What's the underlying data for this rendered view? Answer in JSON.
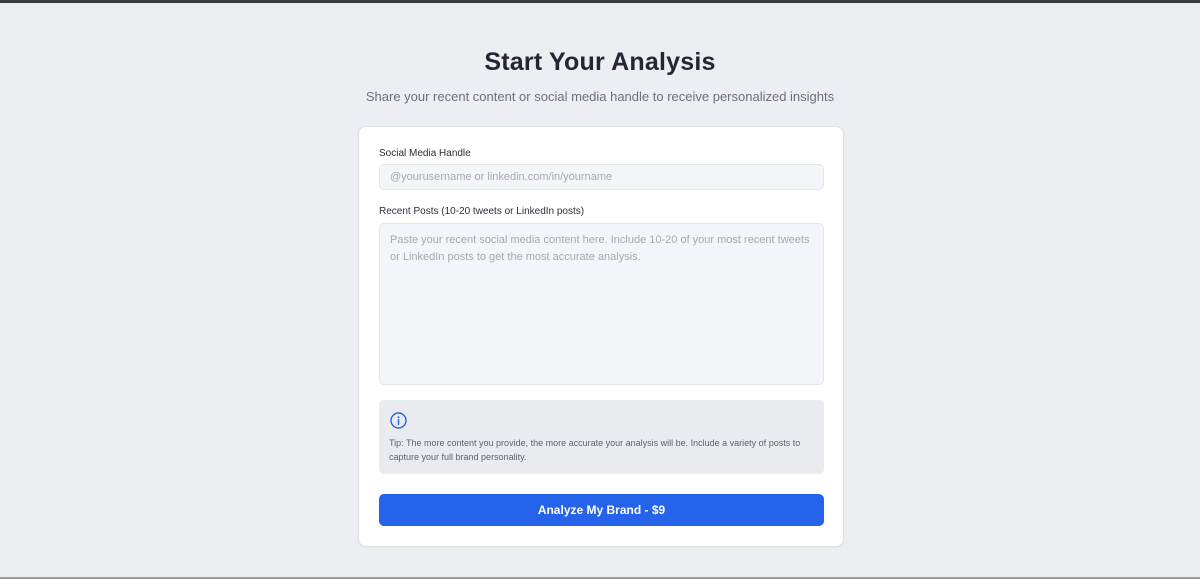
{
  "header": {
    "title": "Start Your Analysis",
    "subtitle": "Share your recent content or social media handle to receive personalized insights"
  },
  "form": {
    "handle_label": "Social Media Handle",
    "handle_placeholder": "@yourusername or linkedin.com/in/yourname",
    "handle_value": "",
    "posts_label": "Recent Posts (10-20 tweets or LinkedIn posts)",
    "posts_placeholder": "Paste your recent social media content here. Include 10-20 of your most recent tweets or LinkedIn posts to get the most accurate analysis.",
    "posts_value": "",
    "tip_icon": "info-icon",
    "tip_text": "Tip: The more content you provide, the more accurate your analysis will be. Include a variety of posts to capture your full brand personality.",
    "submit_label": "Analyze My Brand - $9"
  },
  "colors": {
    "accent": "#2563eb",
    "background": "#eceef2",
    "card": "#ffffff",
    "tip_background": "#eaebef"
  }
}
